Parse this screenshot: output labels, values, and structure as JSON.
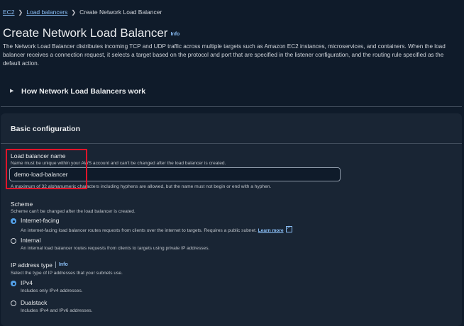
{
  "breadcrumb": {
    "ec2": "EC2",
    "load_balancers": "Load balancers",
    "current": "Create Network Load Balancer"
  },
  "page": {
    "title": "Create Network Load Balancer",
    "info": "Info",
    "description": "The Network Load Balancer distributes incoming TCP and UDP traffic across multiple targets such as Amazon EC2 instances, microservices, and containers. When the load balancer receives a connection request, it selects a target based on the protocol and port that are specified in the listener configuration, and the routing rule specified as the default action."
  },
  "expander": {
    "label": "How Network Load Balancers work"
  },
  "basic": {
    "heading": "Basic configuration",
    "name": {
      "label": "Load balancer name",
      "hint": "Name must be unique within your AWS account and can't be changed after the load balancer is created.",
      "value": "demo-load-balancer",
      "constraint": "A maximum of 32 alphanumeric characters including hyphens are allowed, but the name must not begin or end with a hyphen."
    },
    "scheme": {
      "label": "Scheme",
      "hint": "Scheme can't be changed after the load balancer is created.",
      "options": [
        {
          "label": "Internet-facing",
          "desc": "An internet-facing load balancer routes requests from clients over the internet to targets. Requires a public subnet.",
          "link": "Learn more"
        },
        {
          "label": "Internal",
          "desc": "An internal load balancer routes requests from clients to targets using private IP addresses."
        }
      ]
    },
    "ip": {
      "label": "IP address type",
      "info": "Info",
      "hint": "Select the type of IP addresses that your subnets use.",
      "options": [
        {
          "label": "IPv4",
          "desc": "Includes only IPv4 addresses."
        },
        {
          "label": "Dualstack",
          "desc": "Includes IPv4 and IPv6 addresses."
        }
      ]
    }
  },
  "colors": {
    "background": "#0f1b2a",
    "panel": "#192534",
    "link": "#89bdf4",
    "selected": "#539fe5",
    "highlight": "#e0142a"
  }
}
